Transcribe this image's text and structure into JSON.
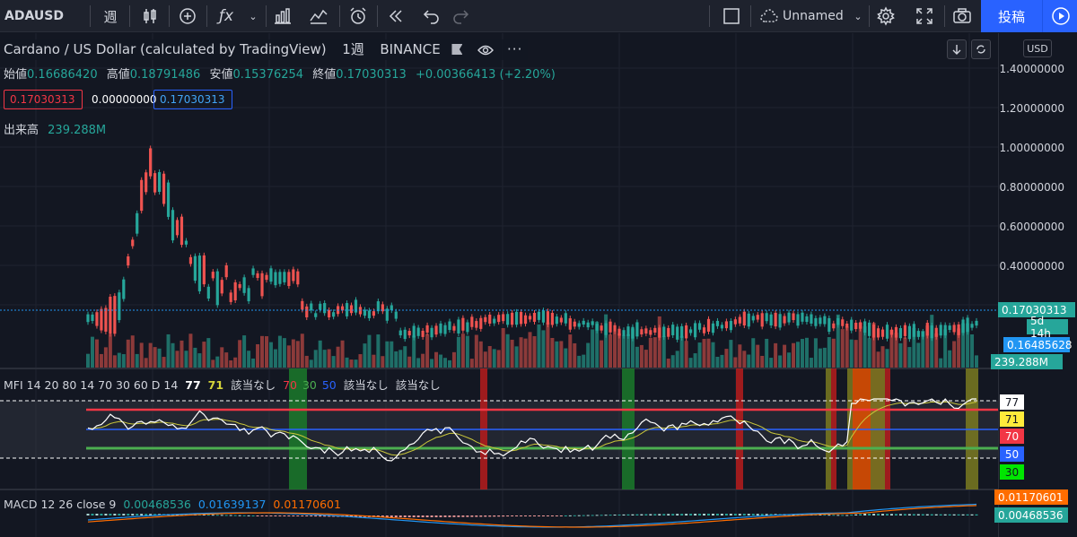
{
  "toolbar": {
    "symbol": "ADAUSD",
    "interval": "週",
    "layout_name": "Unnamed",
    "publish_label": "投稿"
  },
  "legend": {
    "title": "Cardano / US Dollar (calculated by TradingView)",
    "interval": "1週",
    "exchange": "BINANCE",
    "ohlc": {
      "open_label": "始値",
      "open": "0.16686420",
      "high_label": "高値",
      "high": "0.18791486",
      "low_label": "安値",
      "low": "0.15376254",
      "close_label": "終値",
      "close": "0.17030313",
      "change": "+0.00366413 (+2.20%)"
    },
    "box1": "0.17030313",
    "box2": "0.00000000",
    "box3": "0.17030313",
    "volume_label": "出来高",
    "volume_value": "239.288M"
  },
  "price_axis": {
    "currency": "USD",
    "labels": [
      "1.40000000",
      "1.20000000",
      "1.00000000",
      "0.80000000",
      "0.60000000",
      "0.40000000"
    ],
    "last_price": "0.17030313",
    "countdown": "5d 14h",
    "ma_value": "0.16485628",
    "volume_value": "239.288M"
  },
  "mfi": {
    "title": "MFI 14 20 80 14 70 30 60 D 14",
    "v1": "77",
    "v2": "71",
    "n1": "該当なし",
    "v3": "70",
    "v4": "30",
    "v5": "50",
    "n2": "該当なし",
    "n3": "該当なし",
    "tags": [
      "77",
      "71",
      "70",
      "50",
      "30"
    ],
    "colors": {
      "overbought": "#f23645",
      "oversold": "#4caf50",
      "mid": "#2962ff",
      "mfi_line": "#ffffff",
      "signal": "#c9c63a"
    }
  },
  "macd": {
    "title": "MACD 12 26 close 9",
    "hist": "0.00468536",
    "macd": "0.01639137",
    "signal": "0.01170601",
    "tag_signal": "0.01170601",
    "tag_hist": "0.00468536",
    "colors": {
      "hist": "#26a69a",
      "macd": "#2196f3",
      "signal": "#ff6d00"
    }
  },
  "colors": {
    "up": "#26a69a",
    "down": "#ef5350",
    "accent": "#2962ff"
  }
}
